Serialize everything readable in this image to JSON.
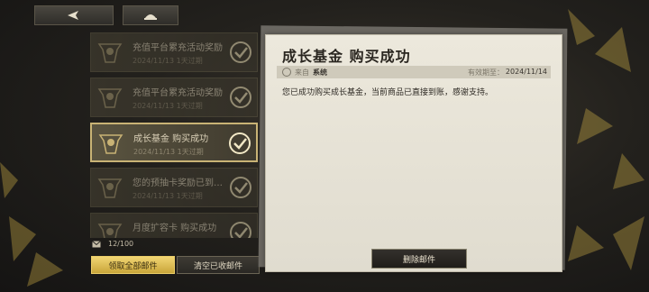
{
  "nav": {
    "back_icon": "back-arrow-icon",
    "home_icon": "home-icon"
  },
  "mails": [
    {
      "title": "充值平台累充活动奖励",
      "date": "2024/11/13",
      "expires": "1天过期",
      "state": "read"
    },
    {
      "title": "充值平台累充活动奖励",
      "date": "2024/11/13",
      "expires": "1天过期",
      "state": "read"
    },
    {
      "title": "成长基金 购买成功",
      "date": "2024/11/13",
      "expires": "1天过期",
      "state": "selected"
    },
    {
      "title": "您的预抽卡奖励已到…",
      "date": "2024/11/13",
      "expires": "1天过期",
      "state": "read"
    },
    {
      "title": "月度扩容卡 购买成功",
      "date": "",
      "expires": "",
      "state": "read"
    }
  ],
  "mailbox": {
    "count": "12/100",
    "collect_all": "领取全部邮件",
    "clear_read": "清空已收邮件"
  },
  "detail": {
    "title": "成长基金 购买成功",
    "from_label": "来自",
    "from_value": "系统",
    "expiry_label": "有效期至：",
    "expiry_value": "2024/11/14",
    "body": "您已成功购买成长基金，当前商品已直接到账，感谢支持。",
    "delete_label": "删除邮件"
  },
  "colors": {
    "accent_gold": "#d9b84a",
    "paper": "#e8e4d8",
    "panel": "#423d31"
  }
}
